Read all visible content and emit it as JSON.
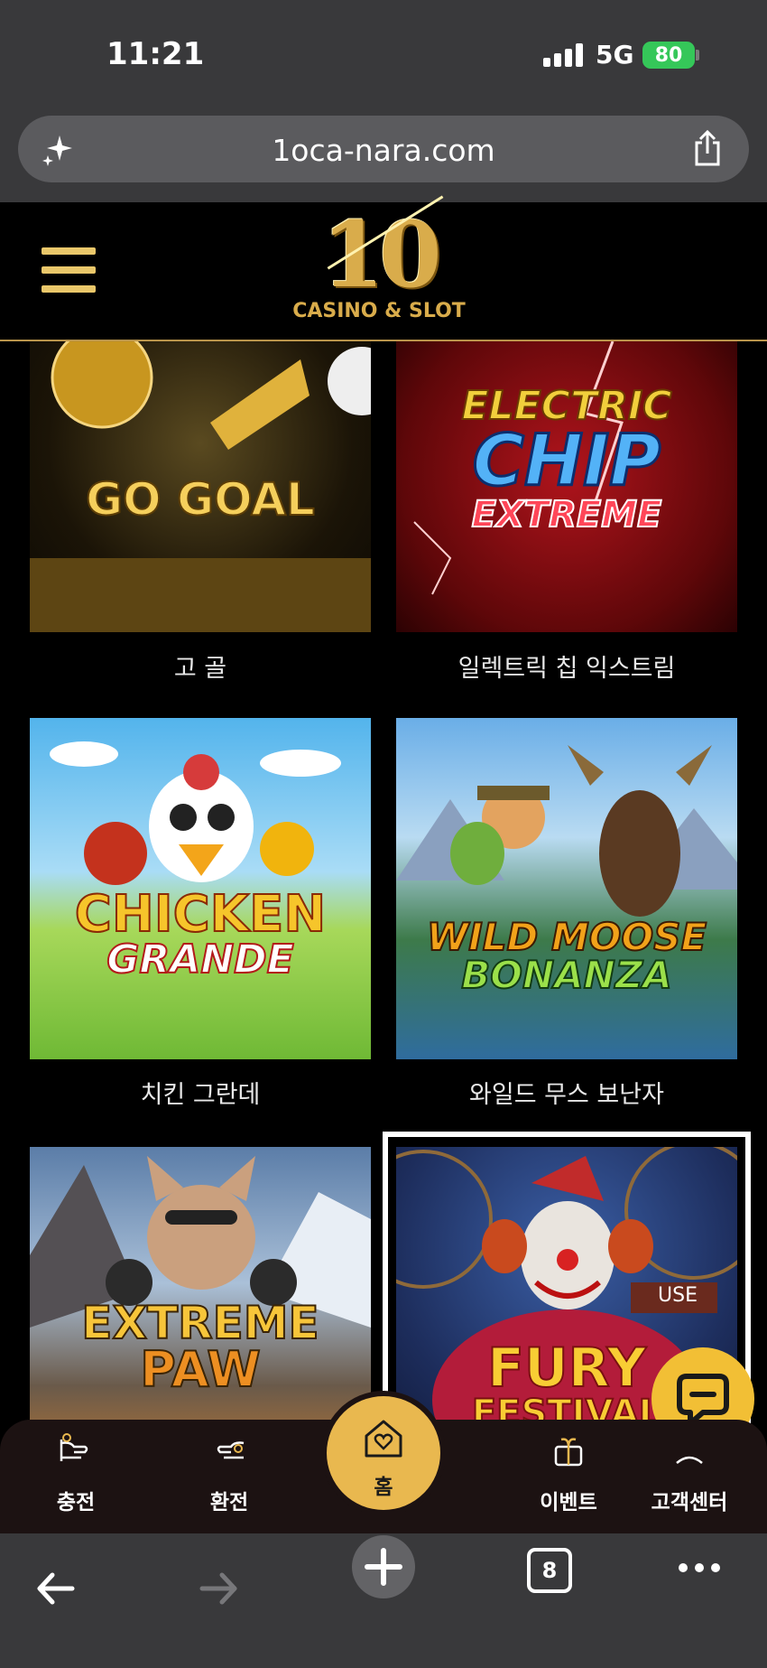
{
  "status_bar": {
    "time": "11:21",
    "network": "5G",
    "battery": "80"
  },
  "browser": {
    "url": "1oca-nara.com",
    "open_tabs": "8"
  },
  "site": {
    "logo_number": "10",
    "logo_text": "CASINO & SLOT"
  },
  "games": [
    {
      "label": "고 골",
      "art_title": [
        "GO GOAL"
      ]
    },
    {
      "label": "일렉트릭 칩 익스트림",
      "art_title": [
        "ELECTRIC",
        "CHIP",
        "EXTREME"
      ]
    },
    {
      "label": "치킨 그란데",
      "art_title": [
        "CHICKEN",
        "GRANDE"
      ]
    },
    {
      "label": "와일드 무스 보난자",
      "art_title": [
        "WILD MOOSE",
        "BONANZA"
      ]
    },
    {
      "label": "",
      "art_title": [
        "EXTREME",
        "PAW"
      ]
    },
    {
      "label": "",
      "art_title": [
        "USE",
        "FURY",
        "FESTIVAL"
      ]
    }
  ],
  "tabbar": {
    "charge": "충전",
    "exchange": "환전",
    "home": "홈",
    "event": "이벤트",
    "support": "고객센터"
  },
  "colors": {
    "gold": "#e9b84f",
    "chat": "#f2bf35",
    "chrome": "#39393b"
  }
}
